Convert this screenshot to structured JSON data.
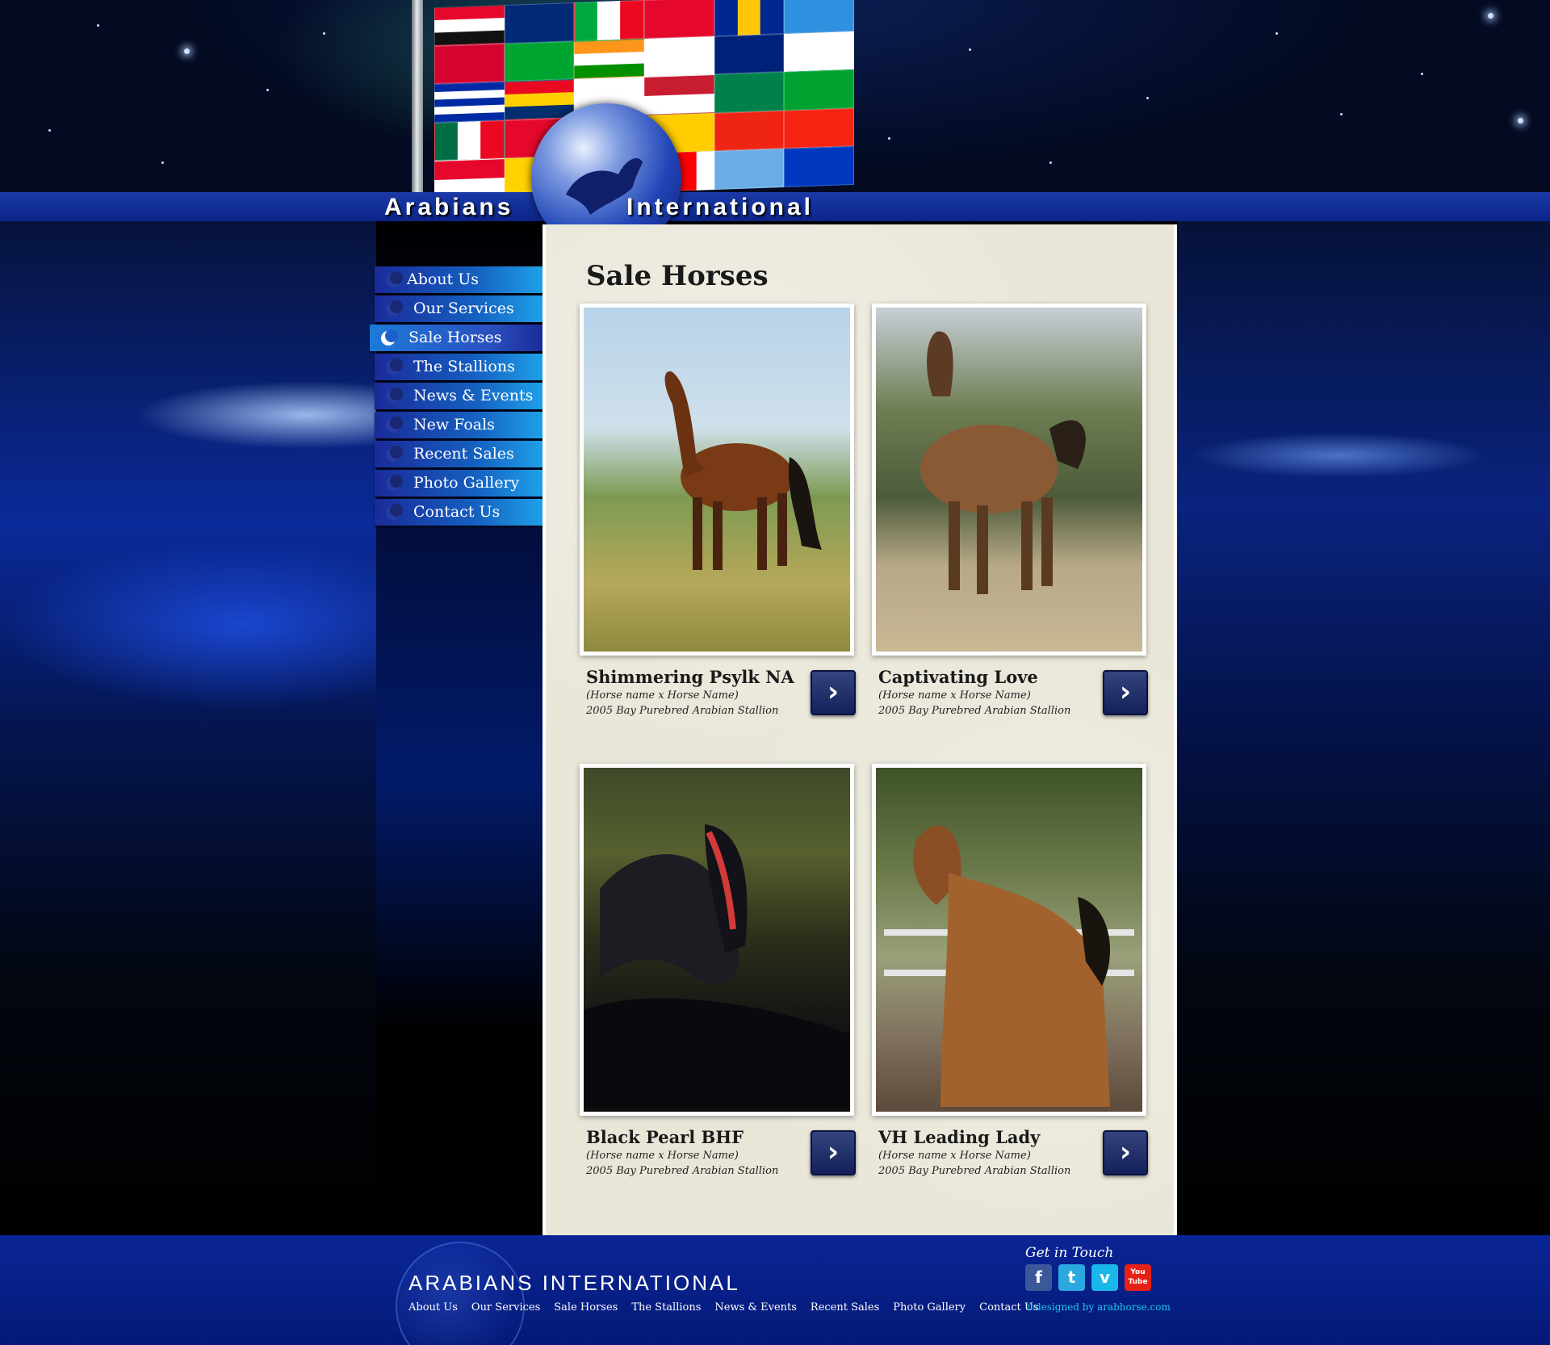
{
  "brand": {
    "left_word": "Arabians",
    "right_word": "International"
  },
  "nav": {
    "items": [
      {
        "label": "About Us"
      },
      {
        "label": "Our Services"
      },
      {
        "label": "Sale Horses",
        "active": true
      },
      {
        "label": "The Stallions"
      },
      {
        "label": "News & Events"
      },
      {
        "label": "New Foals"
      },
      {
        "label": "Recent Sales"
      },
      {
        "label": "Photo Gallery"
      },
      {
        "label": "Contact Us"
      }
    ]
  },
  "main": {
    "title": "Sale Horses",
    "horses": [
      {
        "name": "Shimmering Psylk NA",
        "pedigree": "(Horse name x Horse Name)",
        "description": "2005 Bay Purebred Arabian Stallion",
        "icon": "chevron-right-icon"
      },
      {
        "name": "Captivating Love",
        "pedigree": "(Horse name x Horse Name)",
        "description": "2005 Bay Purebred Arabian Stallion",
        "icon": "chevron-right-icon"
      },
      {
        "name": "Black Pearl BHF",
        "pedigree": "(Horse name x Horse Name)",
        "description": "2005 Bay Purebred Arabian Stallion",
        "icon": "chevron-right-icon"
      },
      {
        "name": "VH Leading Lady",
        "pedigree": "(Horse name x Horse Name)",
        "description": "2005 Bay Purebred Arabian Stallion",
        "icon": "chevron-right-icon"
      }
    ]
  },
  "footer": {
    "brand": "ARABIANS INTERNATIONAL",
    "nav": [
      "About Us",
      "Our Services",
      "Sale Horses",
      "The Stallions",
      "News & Events",
      "Recent Sales",
      "Photo Gallery",
      "Contact Us"
    ],
    "get_in_touch": "Get in Touch",
    "social": [
      {
        "label": "f",
        "icon": "facebook-icon",
        "color": "#3b5998"
      },
      {
        "label": "t",
        "icon": "twitter-icon",
        "color": "#2aa9e0"
      },
      {
        "label": "v",
        "icon": "vimeo-icon",
        "color": "#1ab7ea"
      },
      {
        "label": "You Tube",
        "icon": "youtube-icon",
        "color": "#e62117"
      }
    ],
    "credit": "©designed by arabhorse.com"
  },
  "colors": {
    "banner": "#0b2488",
    "nav_gradient_end": "#1fa0e8",
    "content_bg": "#e9e6d8",
    "arrow_button": "#14205a",
    "credit_link": "#1ec6f0"
  }
}
